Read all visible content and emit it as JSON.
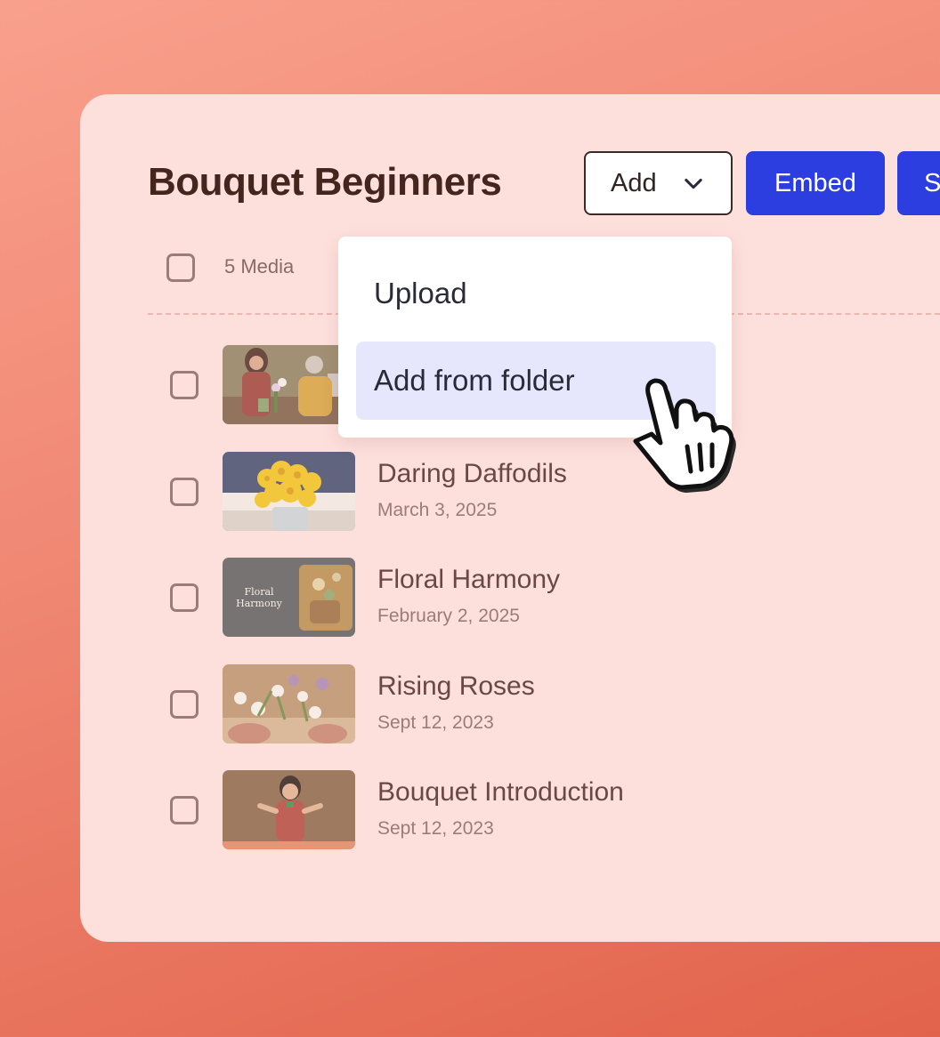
{
  "page": {
    "title": "Bouquet Beginners"
  },
  "toolbar": {
    "add_label": "Add",
    "embed_label": "Embed",
    "share_label": "S"
  },
  "list": {
    "count_label": "5 Media",
    "items": [
      {
        "title": "",
        "date": "",
        "thumb": "florists-workshop"
      },
      {
        "title": "Daring Daffodils",
        "date": "March 3, 2025",
        "thumb": "daffodils"
      },
      {
        "title": "Floral Harmony",
        "date": "February 2, 2025",
        "thumb": "floral-harmony-card",
        "thumb_caption": [
          "Floral",
          "Harmony"
        ]
      },
      {
        "title": "Rising Roses",
        "date": "Sept 12, 2023",
        "thumb": "roses-hands"
      },
      {
        "title": "Bouquet Introduction",
        "date": "Sept 12, 2023",
        "thumb": "presenter"
      }
    ]
  },
  "dropdown": {
    "items": [
      {
        "label": "Upload"
      },
      {
        "label": "Add from folder",
        "highlighted": true
      }
    ]
  },
  "colors": {
    "background": "#ef8672",
    "card": "#fde0dc",
    "title": "#45261f",
    "primary_button": "#2c3ee0",
    "menu_highlight": "#e6e7fd"
  },
  "icons": {
    "add_dropdown": "chevron-down-icon",
    "cursor": "hand-pointer-cursor"
  }
}
